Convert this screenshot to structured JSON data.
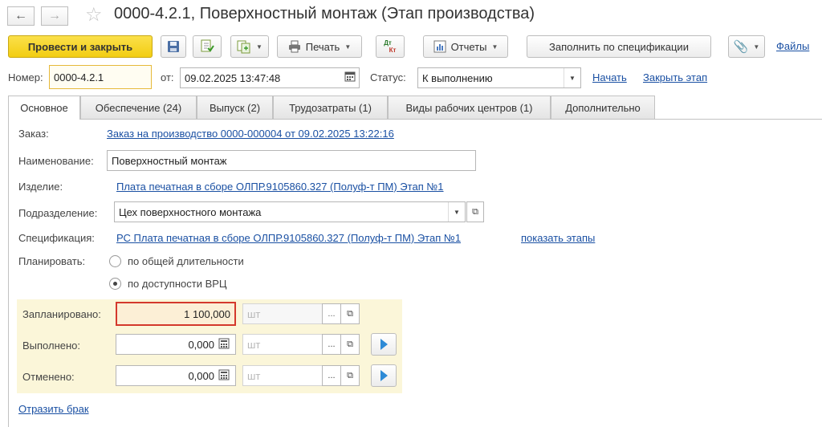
{
  "window": {
    "title": "0000-4.2.1, Поверхностный монтаж (Этап производства)"
  },
  "toolbar": {
    "post_close": "Провести и закрыть",
    "print": "Печать",
    "reports": "Отчеты",
    "fill_spec": "Заполнить по спецификации",
    "files": "Файлы",
    "dt_label": "Дт",
    "kt_label": "Кт"
  },
  "header": {
    "number_label": "Номер:",
    "number": "0000-4.2.1",
    "date_label": "от:",
    "date": "09.02.2025 13:47:48",
    "status_label": "Статус:",
    "status": "К выполнению",
    "start_link": "Начать",
    "close_stage_link": "Закрыть этап"
  },
  "tabs": [
    {
      "label": "Основное"
    },
    {
      "label": "Обеспечение (24)"
    },
    {
      "label": "Выпуск (2)"
    },
    {
      "label": "Трудозатраты (1)"
    },
    {
      "label": "Виды рабочих центров (1)"
    },
    {
      "label": "Дополнительно"
    }
  ],
  "form": {
    "order_label": "Заказ:",
    "order_link": "Заказ на производство 0000-000004 от 09.02.2025 13:22:16",
    "name_label": "Наименование:",
    "name_value": "Поверхностный монтаж",
    "product_label": "Изделие:",
    "product_link": "Плата печатная в сборе ОЛПР.9105860.327 (Полуф-т ПМ) Этап №1",
    "division_label": "Подразделение:",
    "division_value": "Цех поверхностного монтажа",
    "spec_label": "Спецификация:",
    "spec_link": "РС  Плата печатная в сборе ОЛПР.9105860.327 (Полуф-т ПМ) Этап №1",
    "show_stages_link": "показать этапы",
    "plan_label": "Планировать:",
    "plan_option_1": "по общей длительности",
    "plan_option_2": "по доступности ВРЦ",
    "plan_selected": 2
  },
  "quantities": {
    "planned_label": "Запланировано:",
    "planned_value": "1 100,000",
    "done_label": "Выполнено:",
    "done_value": "0,000",
    "cancelled_label": "Отменено:",
    "cancelled_value": "0,000",
    "unit": "шт"
  },
  "footer": {
    "defect_link": "Отразить брак"
  },
  "colors": {
    "primary_button": "#f5d51f",
    "highlight_panel": "#fbf6d9",
    "focus_border": "#d4392c",
    "link": "#1a50a3"
  }
}
